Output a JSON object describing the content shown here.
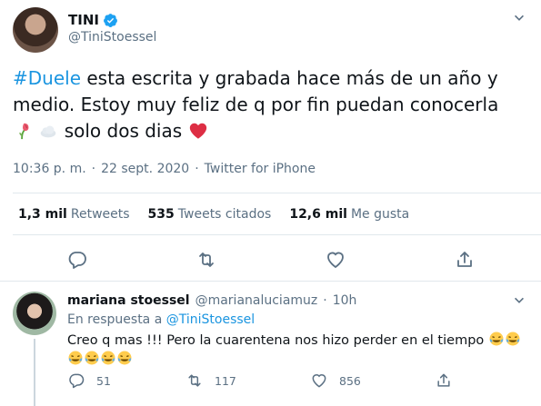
{
  "tweet": {
    "author_name": "TINI",
    "author_handle": "@TiniStoessel",
    "hashtag": "#Duele",
    "text_line1": " esta escrita y grabada hace más de un año y medio. Estoy muy feliz de q por fin puedan conocerla",
    "text_line2": " solo dos dias ",
    "time": "10:36 p. m.",
    "sep1": "·",
    "date": "22 sept. 2020",
    "sep2": "·",
    "source": "Twitter for iPhone",
    "stats": [
      {
        "num": "1,3 mil",
        "label": "Retweets"
      },
      {
        "num": "535",
        "label": "Tweets citados"
      },
      {
        "num": "12,6 mil",
        "label": "Me gusta"
      }
    ],
    "icons": {
      "verified": "verified-badge-icon",
      "caret": "chevron-down-icon",
      "reply": "reply-icon",
      "retweet": "retweet-icon",
      "like": "heart-icon",
      "share": "share-icon"
    },
    "colors": {
      "link": "#1b95e0",
      "muted": "#5b7083",
      "heart": "#e0245e"
    }
  },
  "reply": {
    "author_name": "mariana stoessel",
    "author_handle": "@marianaluciamuz",
    "dot": "·",
    "time": "10h",
    "replying_prefix": "En respuesta a ",
    "replying_to": "@TiniStoessel",
    "text": "Creo q mas !!! Pero la cuarentena nos hizo perder en el tiempo",
    "replies": "51",
    "retweets": "117",
    "likes": "856"
  }
}
